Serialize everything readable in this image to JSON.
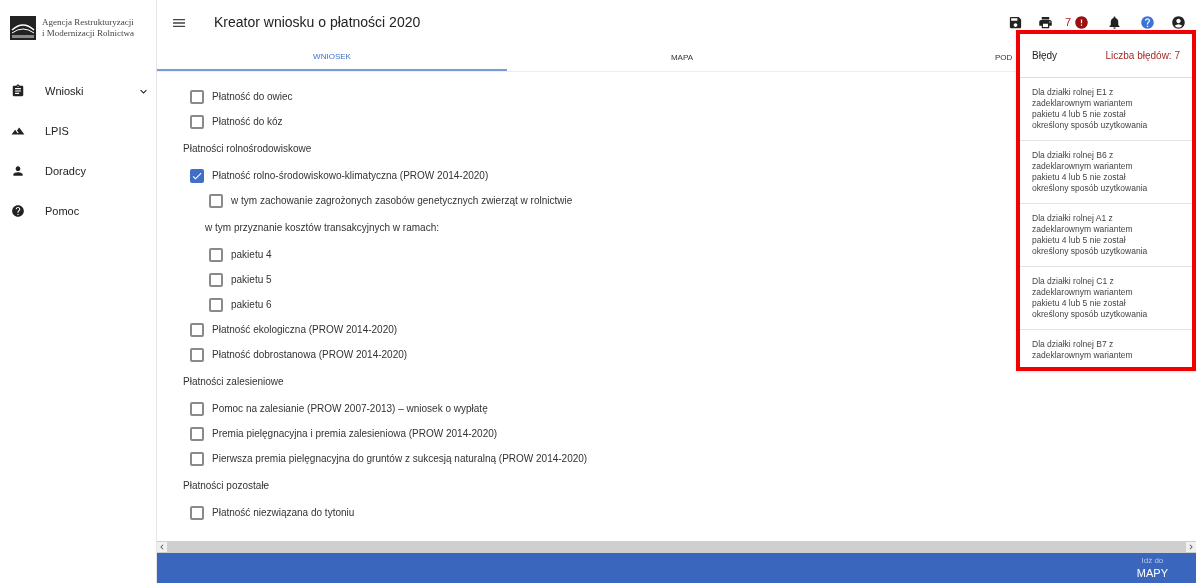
{
  "sidebar": {
    "logo_text": [
      "Agencja Restrukturyzacji",
      "i Modernizacji Rolnictwa"
    ],
    "items": [
      {
        "label": "Wnioski",
        "expandable": true
      },
      {
        "label": "LPIS",
        "expandable": false
      },
      {
        "label": "Doradcy",
        "expandable": false
      },
      {
        "label": "Pomoc",
        "expandable": false
      }
    ]
  },
  "header": {
    "title": "Kreator wniosku o płatności 2020",
    "error_count": "7"
  },
  "tabs": [
    {
      "label": "WNIOSEK",
      "selected": true
    },
    {
      "label": "MAPA",
      "selected": false
    },
    {
      "label": "POD",
      "selected": false
    }
  ],
  "content": {
    "items": [
      {
        "kind": "checkbox",
        "label": "Płatność do owiec",
        "checked": false
      },
      {
        "kind": "checkbox",
        "label": "Płatność do kóz",
        "checked": false
      },
      {
        "kind": "heading",
        "label": "Płatności rolnośrodowiskowe"
      },
      {
        "kind": "checkbox",
        "label": "Płatność rolno-środowiskowo-klimatyczna (PROW 2014-2020)",
        "checked": true,
        "children": [
          {
            "kind": "checkbox",
            "label": "w tym zachowanie zagrożonych zasobów genetycznych zwierząt w rolnictwie",
            "checked": false
          },
          {
            "kind": "text",
            "label": "w tym przyznanie kosztów transakcyjnych w ramach:"
          },
          {
            "kind": "checkbox",
            "label": "pakietu 4",
            "checked": false
          },
          {
            "kind": "checkbox",
            "label": "pakietu 5",
            "checked": false
          },
          {
            "kind": "checkbox",
            "label": "pakietu 6",
            "checked": false
          }
        ]
      },
      {
        "kind": "checkbox",
        "label": "Płatność ekologiczna (PROW 2014-2020)",
        "checked": false
      },
      {
        "kind": "checkbox",
        "label": "Płatność dobrostanowa (PROW 2014-2020)",
        "checked": false
      },
      {
        "kind": "heading",
        "label": "Płatności zalesieniowe"
      },
      {
        "kind": "checkbox",
        "label": "Pomoc na zalesianie (PROW 2007-2013) – wniosek o wypłatę",
        "checked": false
      },
      {
        "kind": "checkbox",
        "label": "Premia pielęgnacyjna i premia zalesieniowa (PROW 2014-2020)",
        "checked": false
      },
      {
        "kind": "checkbox",
        "label": "Pierwsza premia pielęgnacyjna do gruntów z sukcesją naturalną (PROW 2014-2020)",
        "checked": false
      },
      {
        "kind": "heading",
        "label": "Płatności pozostałe"
      },
      {
        "kind": "checkbox",
        "label": "Płatność niezwiązana do tytoniu",
        "checked": false
      }
    ]
  },
  "errors_panel": {
    "title": "Błędy",
    "count_label": "Liczba błędów: 7",
    "errors": [
      [
        "Dla działki rolnej E1 z",
        "zadeklarownym wariantem",
        "pakietu 4 lub 5 nie został",
        "określony sposób uzytkowania"
      ],
      [
        "Dla działki rolnej B6 z",
        "zadeklarownym wariantem",
        "pakietu 4 lub 5 nie został",
        "określony sposób uzytkowania"
      ],
      [
        "Dla działki rolnej A1 z",
        "zadeklarownym wariantem",
        "pakietu 4 lub 5 nie został",
        "określony sposób uzytkowania"
      ],
      [
        "Dla działki rolnej C1 z",
        "zadeklarownym wariantem",
        "pakietu 4 lub 5 nie został",
        "określony sposób uzytkowania"
      ],
      [
        "Dla działki rolnej B7 z",
        "zadeklarownym wariantem"
      ]
    ]
  },
  "footer": {
    "goto_small": "Idź do",
    "goto_big": "MAPY"
  }
}
